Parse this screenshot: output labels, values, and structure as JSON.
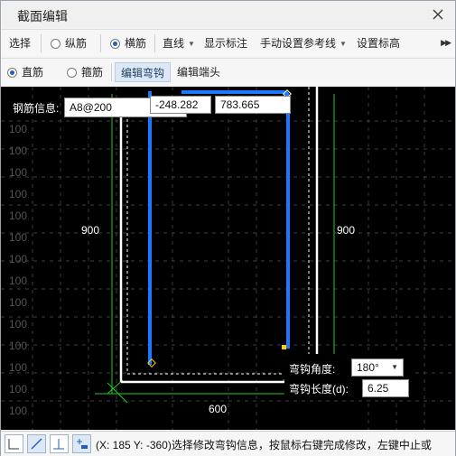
{
  "window": {
    "title": "截面编辑"
  },
  "toolbar": {
    "select": "选择",
    "longitudinal": "纵筋",
    "transverse": "横筋",
    "line": "直线",
    "show_dims": "显示标注",
    "manual_ref": "手动设置参考线",
    "set_elevation": "设置标高"
  },
  "toolbar2": {
    "straight": "直筋",
    "stirrup": "箍筋",
    "edit_hook": "编辑弯钩",
    "edit_end": "编辑端头"
  },
  "canvas": {
    "rebar_info_label": "钢筋信息:",
    "rebar_info_value": "A8@200",
    "coord_x": "-248.282",
    "coord_y": "783.665",
    "dim_left": "900",
    "dim_right": "900",
    "dim_bottom": "600",
    "grid_labels": [
      "100",
      "100",
      "100",
      "100",
      "100",
      "100",
      "100",
      "100",
      "100",
      "100",
      "100",
      "100",
      "100",
      "100"
    ],
    "hook_angle_label": "弯钩角度:",
    "hook_angle_value": "180°",
    "hook_length_label": "弯钩长度(d):",
    "hook_length_value": "6.25",
    "colors": {
      "rebar": "#1e78ff",
      "concrete": "#ffffff",
      "dim": "#22cc22",
      "background": "#000000"
    }
  },
  "status": {
    "text": "(X: 185 Y: -360)选择修改弯钩信息，按鼠标右键完成修改，左键中止或"
  }
}
